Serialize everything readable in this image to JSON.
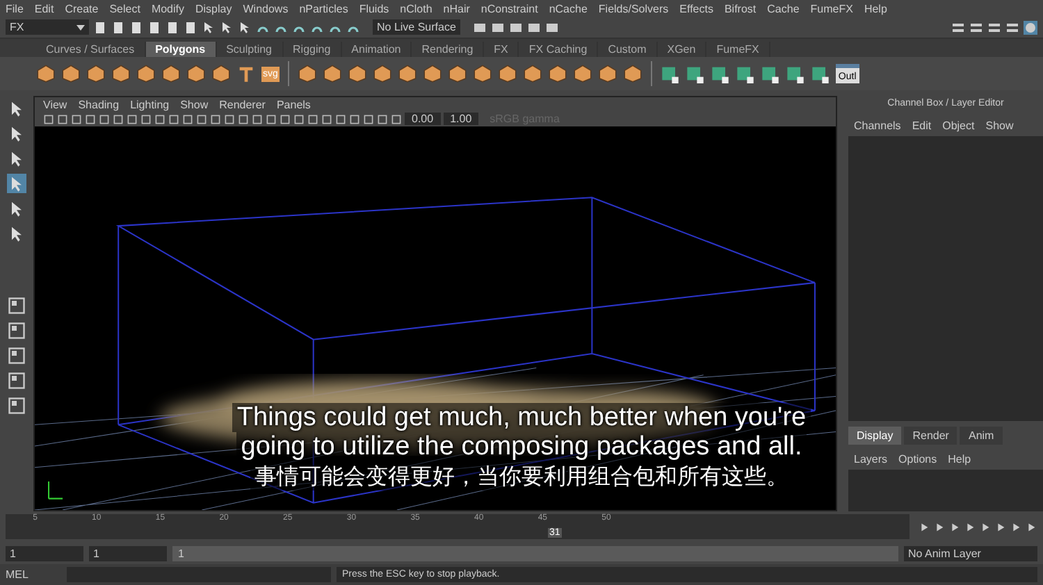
{
  "menu_bar": [
    "File",
    "Edit",
    "Create",
    "Select",
    "Modify",
    "Display",
    "Windows",
    "nParticles",
    "Fluids",
    "nCloth",
    "nHair",
    "nConstraint",
    "nCache",
    "Fields/Solvers",
    "Effects",
    "Bifrost",
    "Cache",
    "FumeFX",
    "Help"
  ],
  "status_line": {
    "menu_set": "FX",
    "live_surface": "No Live Surface"
  },
  "shelf_tabs": [
    {
      "label": "Curves / Surfaces",
      "selected": false
    },
    {
      "label": "Polygons",
      "selected": true
    },
    {
      "label": "Sculpting",
      "selected": false
    },
    {
      "label": "Rigging",
      "selected": false
    },
    {
      "label": "Animation",
      "selected": false
    },
    {
      "label": "Rendering",
      "selected": false
    },
    {
      "label": "FX",
      "selected": false
    },
    {
      "label": "FX Caching",
      "selected": false
    },
    {
      "label": "Custom",
      "selected": false
    },
    {
      "label": "XGen",
      "selected": false
    },
    {
      "label": "FumeFX",
      "selected": false
    }
  ],
  "shelf_icons": [
    {
      "kind": "poly"
    },
    {
      "kind": "poly"
    },
    {
      "kind": "poly"
    },
    {
      "kind": "poly"
    },
    {
      "kind": "poly"
    },
    {
      "kind": "poly"
    },
    {
      "kind": "poly"
    },
    {
      "kind": "poly"
    },
    {
      "kind": "text"
    },
    {
      "kind": "svg",
      "label": "svg"
    },
    {
      "kind": "divider"
    },
    {
      "kind": "poly"
    },
    {
      "kind": "poly"
    },
    {
      "kind": "poly"
    },
    {
      "kind": "poly"
    },
    {
      "kind": "poly"
    },
    {
      "kind": "poly"
    },
    {
      "kind": "poly"
    },
    {
      "kind": "poly"
    },
    {
      "kind": "poly"
    },
    {
      "kind": "poly"
    },
    {
      "kind": "poly"
    },
    {
      "kind": "poly"
    },
    {
      "kind": "poly"
    },
    {
      "kind": "poly"
    },
    {
      "kind": "divider"
    },
    {
      "kind": "uv"
    },
    {
      "kind": "uv"
    },
    {
      "kind": "uv"
    },
    {
      "kind": "uv"
    },
    {
      "kind": "uv"
    },
    {
      "kind": "uv"
    },
    {
      "kind": "uv"
    },
    {
      "kind": "window",
      "label": "Outl"
    }
  ],
  "viewport": {
    "menu": [
      "View",
      "Shading",
      "Lighting",
      "Show",
      "Renderer",
      "Panels"
    ],
    "exposure": "0.00",
    "gamma": "1.00",
    "color_space": "sRGB gamma",
    "color_space_disabled": true
  },
  "channel_box": {
    "title": "Channel Box / Layer Editor",
    "menu": [
      "Channels",
      "Edit",
      "Object",
      "Show"
    ]
  },
  "layer_editor": {
    "tabs": [
      {
        "label": "Display",
        "selected": true
      },
      {
        "label": "Render",
        "selected": false
      },
      {
        "label": "Anim",
        "selected": false
      }
    ],
    "menu": [
      "Layers",
      "Options",
      "Help"
    ]
  },
  "time_slider": {
    "ticks": [
      "5",
      "10",
      "15",
      "20",
      "25",
      "30",
      "35",
      "40",
      "45",
      "50"
    ],
    "current_frame": "31",
    "level": 0.6
  },
  "range_slider": {
    "start": "1",
    "playback_start": "1",
    "range_start": "1",
    "level": 1,
    "anim_layer": "No Anim Layer"
  },
  "command_line": {
    "language": "MEL",
    "help": "Press the ESC key to stop playback."
  },
  "subtitles": [
    "Things could get much, much better when you're",
    "going to utilize the composing packages and all.",
    "事情可能会变得更好，当你要利用组合包和所有这些。"
  ]
}
